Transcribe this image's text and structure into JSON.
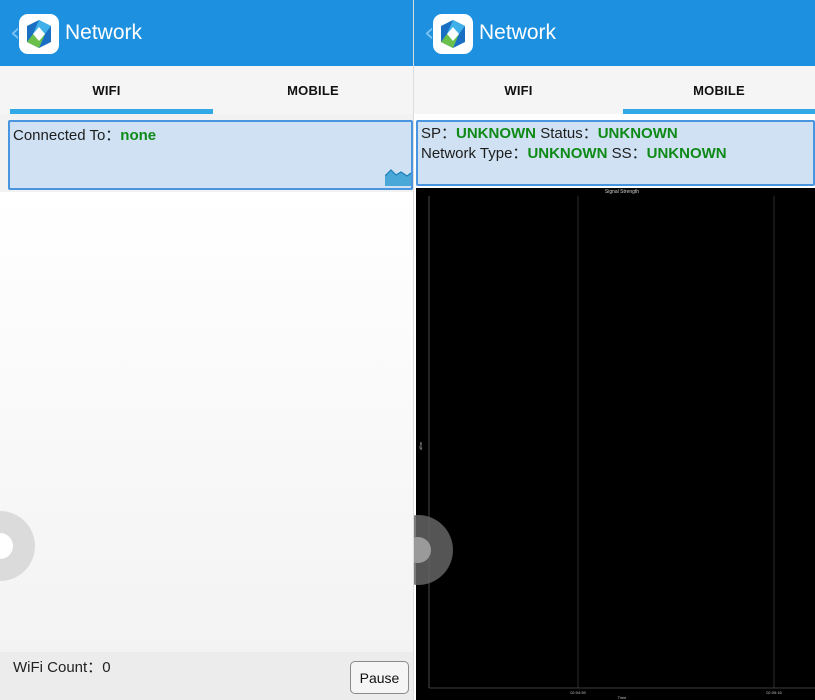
{
  "colors": {
    "appbar": "#1e90e0",
    "tab_indicator": "#33a8e6",
    "value_green": "#0e8a16",
    "info_box_bg": "#cfe1f3",
    "info_box_border": "#4a95e0",
    "chart_bg": "#000000"
  },
  "left": {
    "appbar": {
      "title": "Network",
      "back_icon": "chevron-left-icon",
      "logo_icon": "network-app-logo-icon"
    },
    "tabs": [
      {
        "label": "WIFI",
        "active": true
      },
      {
        "label": "MOBILE",
        "active": false
      }
    ],
    "info": {
      "connected_label": "Connected To：",
      "connected_value": "none",
      "chart_icon": "area-chart-icon"
    },
    "footer": {
      "wifi_count_label": "WiFi Count：",
      "wifi_count_value": "0",
      "pause_label": "Pause"
    }
  },
  "right": {
    "appbar": {
      "title": "Network",
      "back_icon": "chevron-left-icon",
      "logo_icon": "network-app-logo-icon"
    },
    "tabs": [
      {
        "label": "WIFI",
        "active": false
      },
      {
        "label": "MOBILE",
        "active": true
      }
    ],
    "info": {
      "sp_label": "SP：",
      "sp_value": "UNKNOWN",
      "status_label": "Status：",
      "status_value": "UNKNOWN",
      "network_type_label": "Network Type：",
      "network_type_value": "UNKNOWN",
      "ss_label": "SS：",
      "ss_value": "UNKNOWN"
    }
  },
  "chart_data": {
    "type": "line",
    "title": "Signal Strength",
    "xlabel": "Time",
    "ylabel": "dBm",
    "x_tick_labels": [
      "02:04:59",
      "02:05:16"
    ],
    "series": [],
    "grid": true
  }
}
